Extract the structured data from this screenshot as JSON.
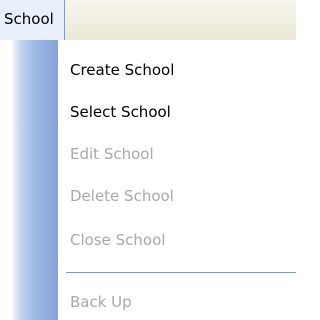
{
  "menubar": {
    "title": "School"
  },
  "menu": {
    "items": [
      {
        "label": "Create School",
        "enabled": true
      },
      {
        "label": "Select School",
        "enabled": true
      },
      {
        "label": "Edit School",
        "enabled": false
      },
      {
        "label": "Delete School",
        "enabled": false
      },
      {
        "label": "Close School",
        "enabled": false
      },
      {
        "label": "Back Up",
        "enabled": false
      }
    ]
  }
}
